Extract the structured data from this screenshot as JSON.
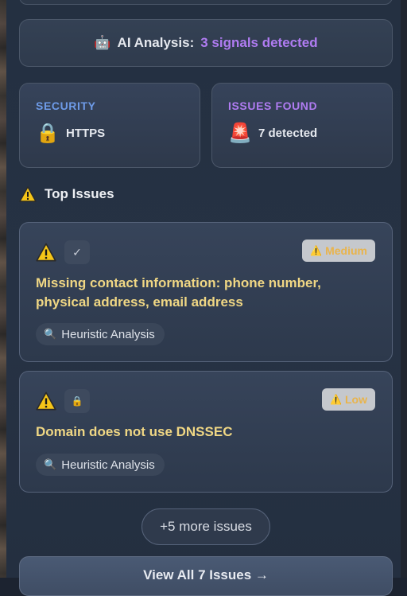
{
  "ai_banner": {
    "icon": "robot-icon",
    "prefix": "AI Analysis:",
    "highlight": "3 signals detected"
  },
  "stats": {
    "security": {
      "label": "SECURITY",
      "icon": "lock-icon",
      "value": "HTTPS"
    },
    "issues": {
      "label": "ISSUES FOUND",
      "icon": "siren-icon",
      "value": "7 detected"
    }
  },
  "top_issues": {
    "title": "Top Issues",
    "items": [
      {
        "icon": "check-icon",
        "severity": "Medium",
        "text": "Missing contact information: phone number, physical address, email address",
        "source": "Heuristic Analysis"
      },
      {
        "icon": "lock-icon",
        "severity": "Low",
        "text": "Domain does not use DNSSEC",
        "source": "Heuristic Analysis"
      }
    ]
  },
  "more_button": "+5 more issues",
  "view_all_button": "View All 7 Issues →",
  "colors": {
    "accent_purple": "#b07cf2",
    "accent_blue": "#6e9be8",
    "issue_text": "#f0d784",
    "severity_text": "#e9b44c"
  }
}
